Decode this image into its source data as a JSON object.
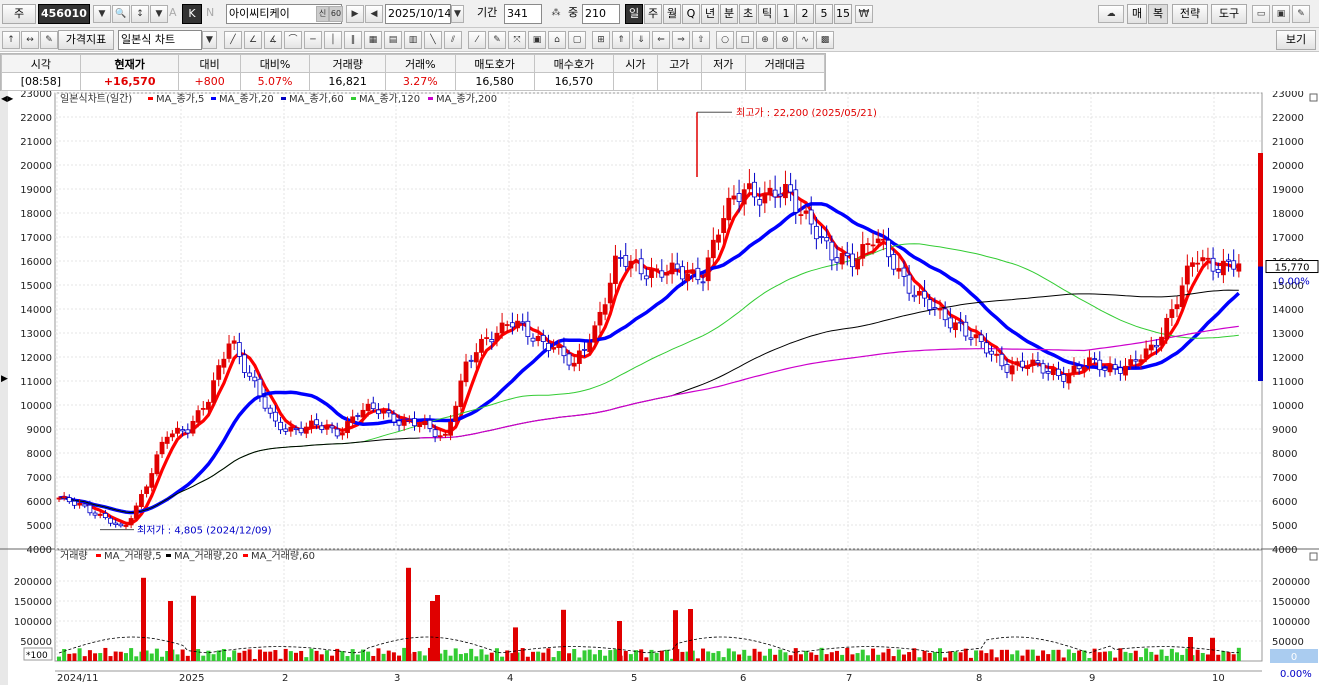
{
  "toolbar": {
    "market_label": "주",
    "code": "456010",
    "stock_name": "아이씨티케이",
    "credit_badge": "신",
    "credit_value": "60",
    "date": "2025/10/14",
    "period_label": "기간",
    "period_value": "341",
    "zoom_label": "중",
    "zoom_value": "210",
    "letter_a": "A",
    "letter_k": "K",
    "letter_n": "N",
    "intervals": [
      "일",
      "주",
      "월",
      "Q",
      "년",
      "분",
      "초",
      "틱",
      "1",
      "2",
      "5",
      "15"
    ],
    "unit_icon": "₩",
    "right_buttons": [
      "매",
      "복",
      "전략",
      "도구"
    ],
    "price_indicator": "가격지표",
    "chart_type": "일본식 차트",
    "view_button": "보기"
  },
  "quote": {
    "headers": [
      "시각",
      "현재가",
      "대비",
      "대비%",
      "거래량",
      "거래%",
      "매도호가",
      "매수호가",
      "시가",
      "고가",
      "저가",
      "거래대금"
    ],
    "values": [
      "[08:58]",
      "+16,570",
      "+800",
      "5.07%",
      "16,821",
      "3.27%",
      "16,580",
      "16,570",
      "",
      "",
      "",
      ""
    ]
  },
  "legend": {
    "chart_name": "일본식차트(일간)",
    "items": [
      {
        "label": "MA_종가,5",
        "color": "#ff0000"
      },
      {
        "label": "MA_종가,20",
        "color": "#0000ff"
      },
      {
        "label": "MA_종가,60",
        "color": "#0000c0"
      },
      {
        "label": "MA_종가,120",
        "color": "#33cc33"
      },
      {
        "label": "MA_종가,200",
        "color": "#cc00cc"
      }
    ],
    "volume_name": "거래량",
    "volume_items": [
      {
        "label": "MA_거래량,5",
        "color": "#ff0000"
      },
      {
        "label": "MA_거래량,20",
        "color": "#000000"
      },
      {
        "label": "MA_거래량,60",
        "color": "#ff0000"
      }
    ]
  },
  "annotations": {
    "high": "최고가 : 22,200 (2025/05/21)",
    "low": "최저가 : 4,805 (2024/12/09)"
  },
  "price_badge": {
    "value": "15,770",
    "pct": "0.00%"
  },
  "volume_badge": {
    "value": "0",
    "pct": "0.00%"
  },
  "volume_scale_note": "*100",
  "chart_data": {
    "type": "candlestick",
    "title": "일본식차트(일간)",
    "price_axis": {
      "range": [
        4000,
        23000
      ],
      "ticks": [
        4000,
        5000,
        6000,
        7000,
        8000,
        9000,
        10000,
        11000,
        12000,
        13000,
        14000,
        15000,
        16000,
        17000,
        18000,
        19000,
        20000,
        21000,
        22000,
        23000
      ]
    },
    "volume_axis": {
      "range": [
        0,
        250000
      ],
      "ticks": [
        50000,
        100000,
        150000,
        200000
      ]
    },
    "x_labels": [
      "2024/11",
      "2025",
      "2",
      "3",
      "4",
      "5",
      "6",
      "7",
      "8",
      "9",
      "10"
    ],
    "price_path": [
      [
        "2024-11",
        6050
      ],
      [
        "2024-11",
        5900
      ],
      [
        "2024-12",
        5300
      ],
      [
        "2024-12",
        4805
      ],
      [
        "2024-12",
        6500
      ],
      [
        "2024-12",
        8700
      ],
      [
        "2024-12",
        9100
      ],
      [
        "2025-01",
        10200
      ],
      [
        "2025-01",
        12900
      ],
      [
        "2025-01",
        11000
      ],
      [
        "2025-01",
        9200
      ],
      [
        "2025-01",
        9000
      ],
      [
        "2025-02",
        9100
      ],
      [
        "2025-02",
        8900
      ],
      [
        "2025-02",
        9700
      ],
      [
        "2025-02",
        9800
      ],
      [
        "2025-02",
        9300
      ],
      [
        "2025-03",
        9100
      ],
      [
        "2025-03",
        8700
      ],
      [
        "2025-03",
        11600
      ],
      [
        "2025-03",
        12900
      ],
      [
        "2025-03",
        13500
      ],
      [
        "2025-03",
        12800
      ],
      [
        "2025-04",
        12600
      ],
      [
        "2025-04",
        11500
      ],
      [
        "2025-04",
        13300
      ],
      [
        "2025-04",
        16000
      ],
      [
        "2025-04",
        15700
      ],
      [
        "2025-05",
        15600
      ],
      [
        "2025-05",
        15400
      ],
      [
        "2025-05",
        15500
      ],
      [
        "2025-05",
        17800
      ],
      [
        "2025-05",
        19200
      ],
      [
        "2025-06",
        18600
      ],
      [
        "2025-06",
        18800
      ],
      [
        "2025-06",
        17800
      ],
      [
        "2025-06",
        16000
      ],
      [
        "2025-06",
        16200
      ],
      [
        "2025-07",
        16900
      ],
      [
        "2025-07",
        15800
      ],
      [
        "2025-07",
        14600
      ],
      [
        "2025-07",
        13700
      ],
      [
        "2025-07",
        13400
      ],
      [
        "2025-08",
        12400
      ],
      [
        "2025-08",
        11700
      ],
      [
        "2025-08",
        11700
      ],
      [
        "2025-08",
        11400
      ],
      [
        "2025-08",
        11300
      ],
      [
        "2025-09",
        11700
      ],
      [
        "2025-09",
        11600
      ],
      [
        "2025-09",
        11600
      ],
      [
        "2025-09",
        12400
      ],
      [
        "2025-09",
        14200
      ],
      [
        "2025-10",
        16100
      ],
      [
        "2025-10",
        15900
      ],
      [
        "2025-10",
        15770
      ]
    ],
    "ma_series": [
      {
        "name": "MA_종가,5",
        "color": "#ff0000"
      },
      {
        "name": "MA_종가,20",
        "color": "#0000ff"
      },
      {
        "name": "MA_종가,60",
        "color": "#0000c0"
      },
      {
        "name": "MA_종가,120",
        "color": "#33cc33"
      },
      {
        "name": "MA_종가,200",
        "color": "#cc00cc"
      }
    ]
  }
}
